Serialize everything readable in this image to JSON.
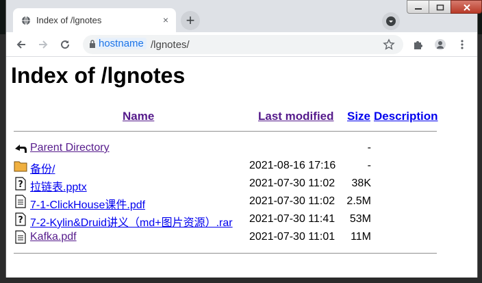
{
  "browser": {
    "tab_title": "Index of /lgnotes",
    "tab_close": "×",
    "new_tab": "+",
    "url_host": "hostname",
    "url_path": "/lgnotes/"
  },
  "page": {
    "heading": "Index of /lgnotes",
    "columns": {
      "name": "Name",
      "modified": "Last modified",
      "size": "Size",
      "description": "Description"
    },
    "rows": [
      {
        "name": "Parent Directory",
        "modified": "",
        "size": "-",
        "icon": "back-icon",
        "visited": true
      },
      {
        "name": "备份/",
        "modified": "2021-08-16 17:16",
        "size": "-",
        "icon": "folder-icon",
        "visited": false
      },
      {
        "name": "拉链表.pptx",
        "modified": "2021-07-30 11:02",
        "size": "38K",
        "icon": "unknown-file-icon",
        "visited": false
      },
      {
        "name": "7-1-ClickHouse课件.pdf",
        "modified": "2021-07-30 11:02",
        "size": "2.5M",
        "icon": "document-icon",
        "visited": false
      },
      {
        "name": "7-2-Kylin&Druid讲义（md+图片资源）.rar",
        "modified": "2021-07-30 11:41",
        "size": "53M",
        "icon": "unknown-file-icon",
        "visited": false
      },
      {
        "name": "Kafka.pdf",
        "modified": "2021-07-30 11:01",
        "size": "11M",
        "icon": "document-icon",
        "visited": true
      }
    ]
  },
  "colors": {
    "link": "#0000ee",
    "visited": "#551a8b",
    "chrome_frame": "#dee1e6"
  }
}
